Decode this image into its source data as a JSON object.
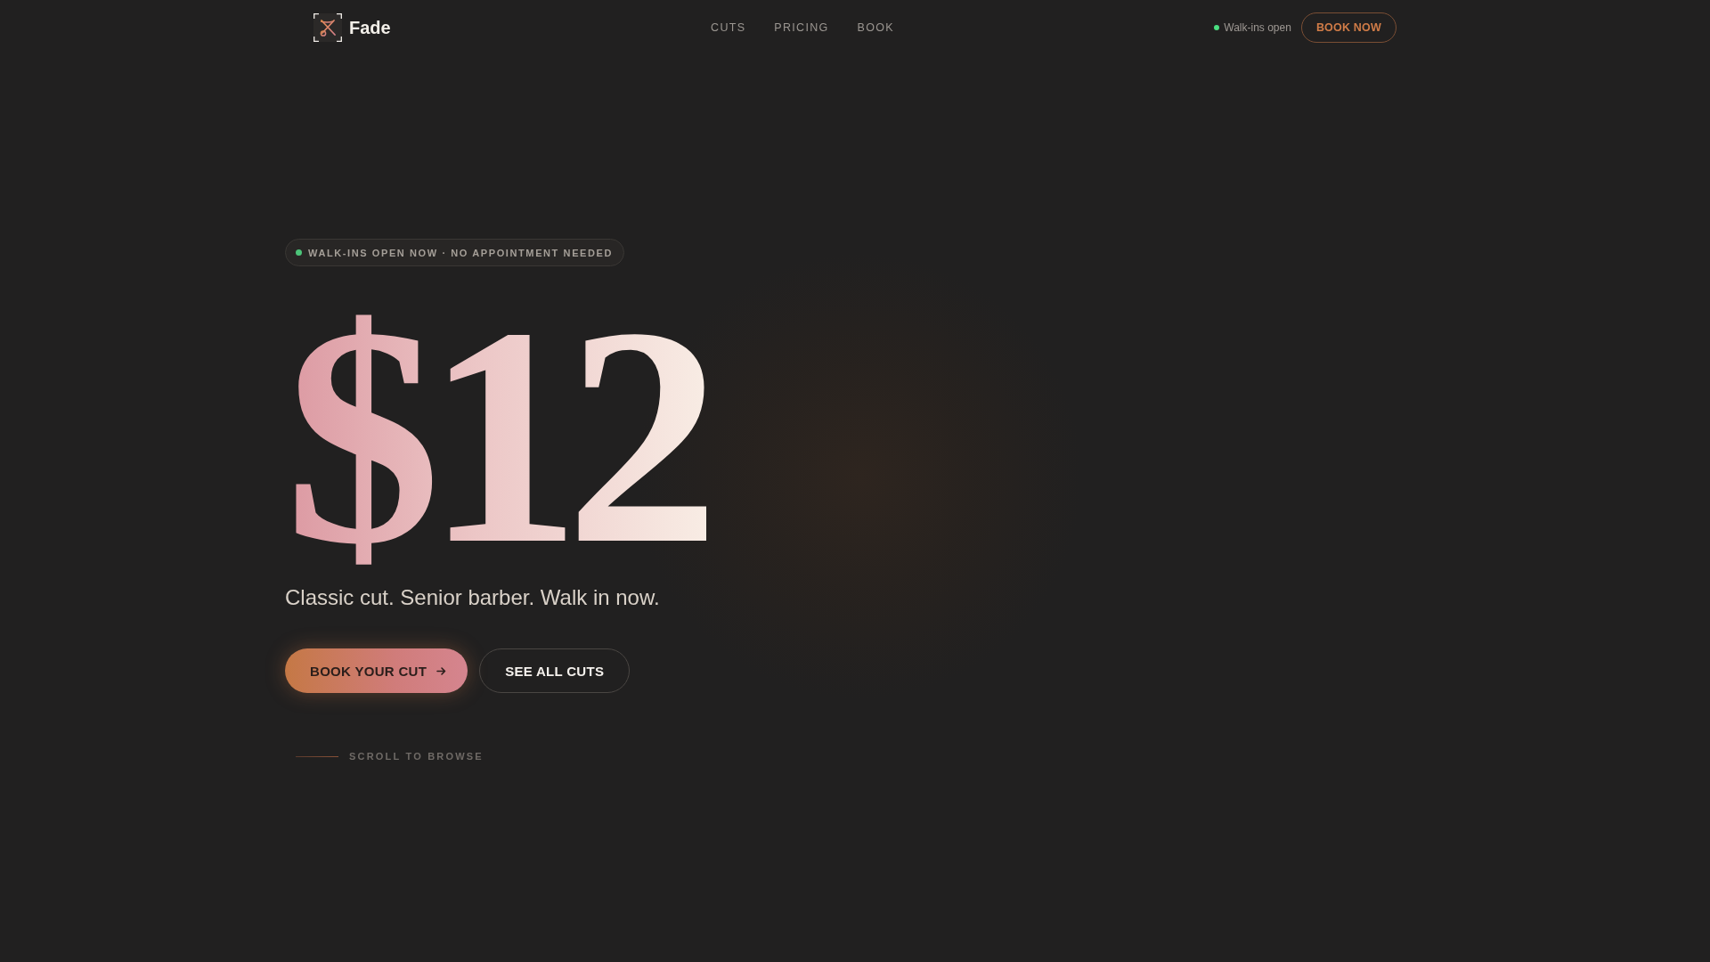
{
  "header": {
    "brand": "Fade",
    "nav": [
      {
        "label": "CUTS"
      },
      {
        "label": "PRICING"
      },
      {
        "label": "BOOK"
      }
    ],
    "status": "Walk-ins open",
    "cta": "BOOK NOW"
  },
  "hero": {
    "badge": "WALK-INS OPEN NOW · NO APPOINTMENT NEEDED",
    "price": "$12",
    "tagline": "Classic cut. Senior barber. Walk in now.",
    "buttons": [
      {
        "label": "BOOK YOUR CUT",
        "kind": "primary"
      },
      {
        "label": "SEE ALL CUTS",
        "kind": "secondary"
      }
    ],
    "scroll_hint": "SCROLL TO BROWSE"
  }
}
